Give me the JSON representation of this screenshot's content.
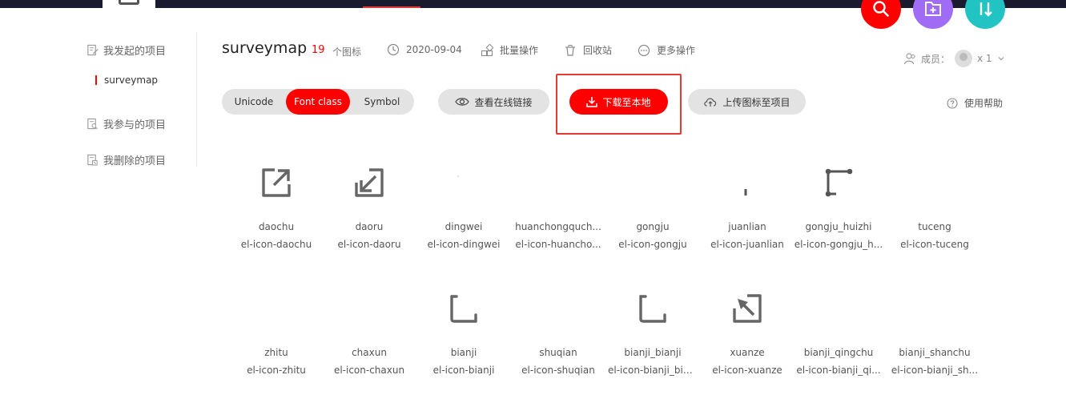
{
  "sidebar": {
    "items": [
      {
        "label": "我发起的项目",
        "icon": "doc-edit-icon"
      },
      {
        "label": "surveymap"
      },
      {
        "label": "我参与的项目",
        "icon": "doc-search-icon"
      },
      {
        "label": "我删除的项目",
        "icon": "doc-delete-icon"
      }
    ]
  },
  "project": {
    "title": "surveymap",
    "icon_count": "19",
    "icon_count_label": "个图标",
    "date": "2020-09-04",
    "batch": "批量操作",
    "recycle": "回收站",
    "more": "更多操作",
    "members_label": "成员：",
    "members_count": "x 1"
  },
  "tabs": {
    "unicode": "Unicode",
    "fontclass": "Font class",
    "symbol": "Symbol",
    "active": "Font class"
  },
  "actions": {
    "view_online": "查看在线链接",
    "download": "下载至本地",
    "upload": "上传图标至项目",
    "help": "使用帮助"
  },
  "colors": {
    "accent": "#ff0000",
    "fab_search": "#ff0000",
    "fab_add": "#a06bf5",
    "fab_sort": "#22c3c3"
  },
  "icons": [
    {
      "name": "daochu",
      "cls": "el-icon-daochu",
      "glyph": "export-icon"
    },
    {
      "name": "daoru",
      "cls": "el-icon-daoru",
      "glyph": "import-icon"
    },
    {
      "name": "dingwei",
      "cls": "el-icon-dingwei",
      "glyph": "locate-icon"
    },
    {
      "name": "huanchongquch...",
      "cls": "el-icon-huancho...",
      "glyph": "buffer-icon"
    },
    {
      "name": "gongju",
      "cls": "el-icon-gongju",
      "glyph": "tool-icon"
    },
    {
      "name": "juanlian",
      "cls": "el-icon-juanlian",
      "glyph": "swipe-icon"
    },
    {
      "name": "gongju_huizhi",
      "cls": "el-icon-gongju_h...",
      "glyph": "draw-tool-icon"
    },
    {
      "name": "tuceng",
      "cls": "el-icon-tuceng",
      "glyph": "layer-icon"
    },
    {
      "name": "zhitu",
      "cls": "el-icon-zhitu",
      "glyph": "map-icon"
    },
    {
      "name": "chaxun",
      "cls": "el-icon-chaxun",
      "glyph": "query-icon"
    },
    {
      "name": "bianji",
      "cls": "el-icon-bianji",
      "glyph": "edit-corner-icon"
    },
    {
      "name": "shuqian",
      "cls": "el-icon-shuqian",
      "glyph": "bookmark-icon"
    },
    {
      "name": "bianji_bianji",
      "cls": "el-icon-bianji_bia...",
      "glyph": "edit-corner-icon"
    },
    {
      "name": "xuanze",
      "cls": "el-icon-xuanze",
      "glyph": "select-icon"
    },
    {
      "name": "bianji_qingchu",
      "cls": "el-icon-bianji_qi...",
      "glyph": "clear-icon"
    },
    {
      "name": "bianji_shanchu",
      "cls": "el-icon-bianji_sh...",
      "glyph": "delete-icon"
    }
  ]
}
